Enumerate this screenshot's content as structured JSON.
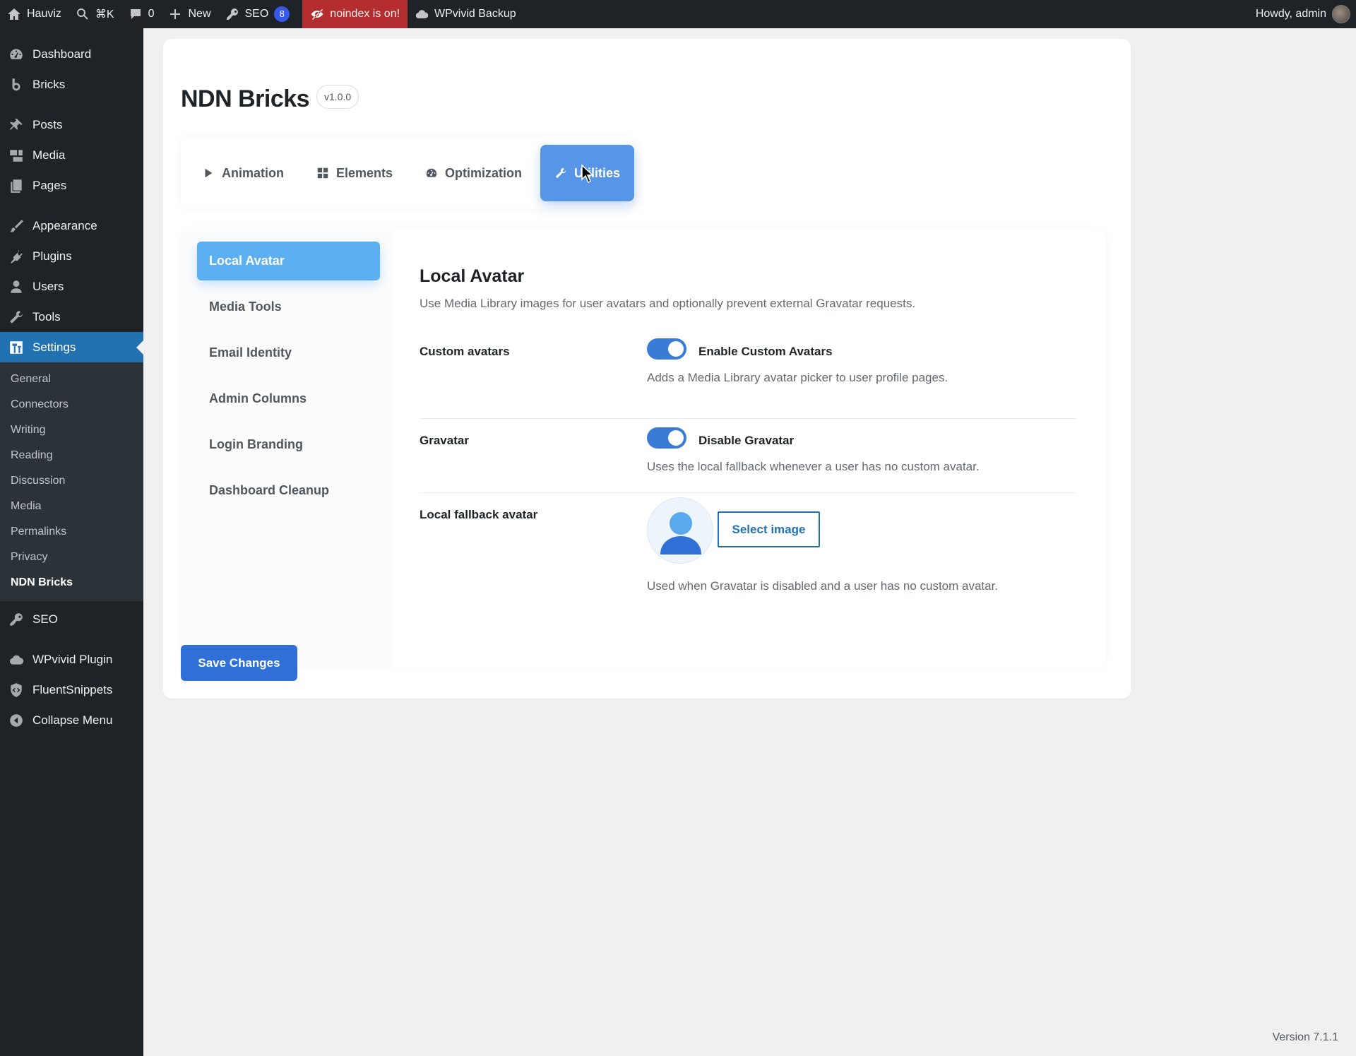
{
  "adminbar": {
    "site_name": "Hauviz",
    "search_shortcut": "⌘K",
    "comments_count": "0",
    "new_label": "New",
    "seo_label": "SEO",
    "seo_count": "8",
    "noindex_label": "noindex is on!",
    "backup_label": "WPvivid Backup",
    "howdy": "Howdy, admin"
  },
  "sidebar": {
    "items": [
      {
        "label": "Dashboard",
        "icon": "dashboard-icon"
      },
      {
        "label": "Bricks",
        "icon": "bricks-icon"
      },
      {
        "label": "Posts",
        "icon": "pin-icon"
      },
      {
        "label": "Media",
        "icon": "media-icon"
      },
      {
        "label": "Pages",
        "icon": "pages-icon"
      },
      {
        "label": "Appearance",
        "icon": "brush-icon"
      },
      {
        "label": "Plugins",
        "icon": "plugin-icon"
      },
      {
        "label": "Users",
        "icon": "user-icon"
      },
      {
        "label": "Tools",
        "icon": "wrench-icon"
      },
      {
        "label": "Settings",
        "icon": "settings-icon"
      },
      {
        "label": "SEO",
        "icon": "seo-icon"
      },
      {
        "label": "WPvivid Plugin",
        "icon": "cloud-icon"
      },
      {
        "label": "FluentSnippets",
        "icon": "shield-icon"
      },
      {
        "label": "Collapse Menu",
        "icon": "collapse-icon"
      }
    ],
    "submenu": [
      "General",
      "Connectors",
      "Writing",
      "Reading",
      "Discussion",
      "Media",
      "Permalinks",
      "Privacy",
      "NDN Bricks"
    ]
  },
  "page": {
    "title": "NDN Bricks",
    "version": "v1.0.0"
  },
  "tabs": [
    {
      "label": "Animation",
      "icon": "play-icon"
    },
    {
      "label": "Elements",
      "icon": "grid-icon"
    },
    {
      "label": "Optimization",
      "icon": "gauge-icon"
    },
    {
      "label": "Utilities",
      "icon": "wrench-icon"
    }
  ],
  "subnav": [
    "Local Avatar",
    "Media Tools",
    "Email Identity",
    "Admin Columns",
    "Login Branding",
    "Dashboard Cleanup"
  ],
  "section": {
    "title": "Local Avatar",
    "description": "Use Media Library images for user avatars and optionally prevent external Gravatar requests.",
    "rows": [
      {
        "label": "Custom avatars",
        "toggle_label": "Enable Custom Avatars",
        "enabled": true,
        "help": "Adds a Media Library avatar picker to user profile pages."
      },
      {
        "label": "Gravatar",
        "toggle_label": "Disable Gravatar",
        "enabled": true,
        "help": "Uses the local fallback whenever a user has no custom avatar."
      },
      {
        "label": "Local fallback avatar",
        "button_label": "Select image",
        "help": "Used when Gravatar is disabled and a user has no custom avatar."
      }
    ]
  },
  "save_label": "Save Changes",
  "footer_version": "Version 7.1.1",
  "colors": {
    "accent": "#2f6fd6",
    "active_tab": "#5795e7",
    "active_subnav": "#5cb0f2",
    "noindex": "#b32d2e"
  }
}
